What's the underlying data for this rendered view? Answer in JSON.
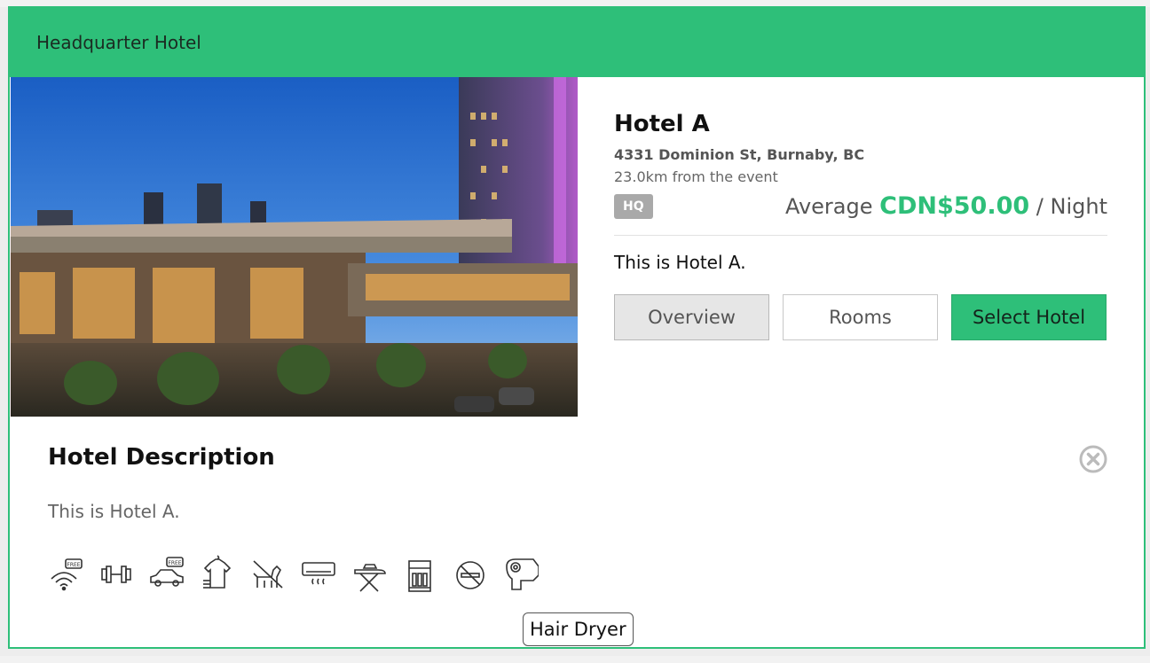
{
  "header": {
    "title": "Headquarter Hotel"
  },
  "hotel": {
    "name": "Hotel A",
    "address": "4331 Dominion St, Burnaby, BC",
    "distance": "23.0km from the event",
    "badge": "HQ",
    "price_prefix": "Average",
    "price_amount": "CDN$50.00",
    "price_suffix": "/ Night",
    "short_description": "This is Hotel A."
  },
  "buttons": {
    "overview": "Overview",
    "rooms": "Rooms",
    "select": "Select Hotel"
  },
  "description": {
    "title": "Hotel Description",
    "text": "This is Hotel A."
  },
  "amenities": [
    {
      "icon": "free-wifi-icon",
      "free_label": "FREE"
    },
    {
      "icon": "fitness-icon"
    },
    {
      "icon": "free-parking-icon",
      "free_label": "FREE"
    },
    {
      "icon": "laundry-icon"
    },
    {
      "icon": "pet-friendly-icon"
    },
    {
      "icon": "air-conditioning-icon"
    },
    {
      "icon": "ironing-board-icon"
    },
    {
      "icon": "minibar-icon"
    },
    {
      "icon": "non-smoking-icon"
    },
    {
      "icon": "hair-dryer-icon"
    }
  ],
  "tooltip": {
    "text": "Hair Dryer"
  },
  "colors": {
    "accent": "#2ebf79",
    "badge": "#a9a9a9",
    "overview_bg": "#e6e6e6"
  }
}
